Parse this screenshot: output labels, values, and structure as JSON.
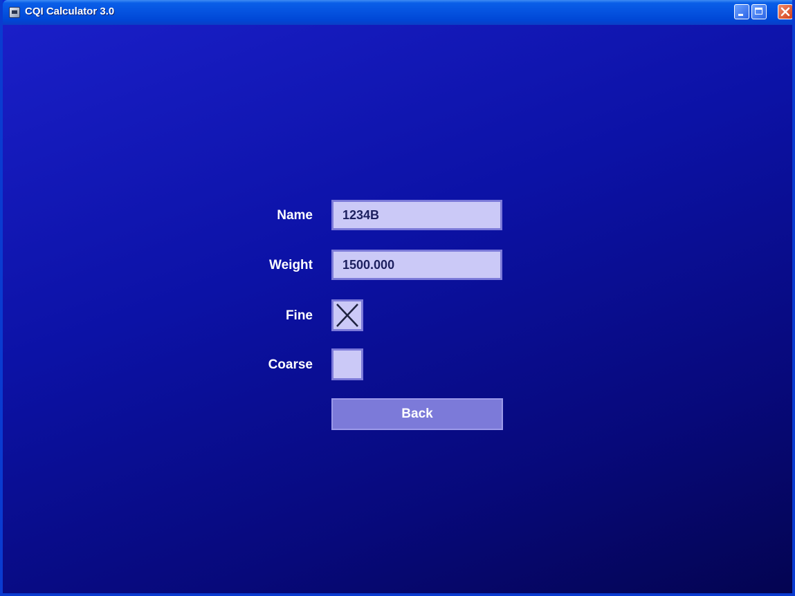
{
  "window": {
    "title": "CQI Calculator 3.0"
  },
  "form": {
    "name_label": "Name",
    "name_value": "1234B",
    "weight_label": "Weight",
    "weight_value": "1500.000",
    "fine_label": "Fine",
    "fine_checked": true,
    "coarse_label": "Coarse",
    "coarse_checked": false,
    "back_label": "Back"
  },
  "icons": {
    "app": "app-icon",
    "minimize": "minimize-icon",
    "maximize": "maximize-icon",
    "close": "close-icon",
    "check": "x-mark-icon"
  },
  "colors": {
    "background": "#0b10a0",
    "field": "#cbc9f7",
    "field_border": "#7c7ad9",
    "button": "#7c7ad9"
  }
}
